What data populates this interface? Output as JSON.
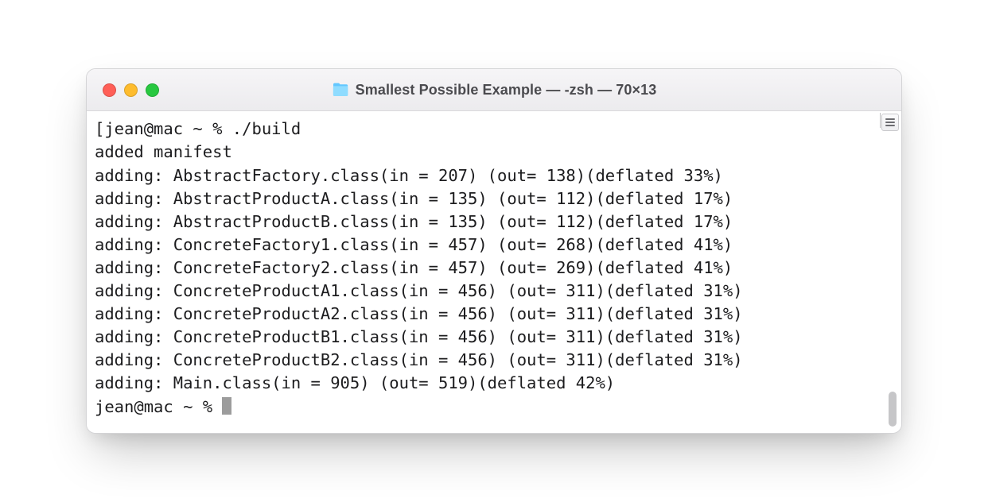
{
  "window": {
    "title": "Smallest Possible Example — -zsh — 70×13"
  },
  "session": {
    "prompt": "jean@mac ~ % ",
    "command": "./build",
    "manifest": "added manifest",
    "entries": [
      {
        "name": "AbstractFactory.class",
        "in": 207,
        "out": 138,
        "deflated": 33
      },
      {
        "name": "AbstractProductA.class",
        "in": 135,
        "out": 112,
        "deflated": 17
      },
      {
        "name": "AbstractProductB.class",
        "in": 135,
        "out": 112,
        "deflated": 17
      },
      {
        "name": "ConcreteFactory1.class",
        "in": 457,
        "out": 268,
        "deflated": 41
      },
      {
        "name": "ConcreteFactory2.class",
        "in": 457,
        "out": 269,
        "deflated": 41
      },
      {
        "name": "ConcreteProductA1.class",
        "in": 456,
        "out": 311,
        "deflated": 31
      },
      {
        "name": "ConcreteProductA2.class",
        "in": 456,
        "out": 311,
        "deflated": 31
      },
      {
        "name": "ConcreteProductB1.class",
        "in": 456,
        "out": 311,
        "deflated": 31
      },
      {
        "name": "ConcreteProductB2.class",
        "in": 456,
        "out": 311,
        "deflated": 31
      },
      {
        "name": "Main.class",
        "in": 905,
        "out": 519,
        "deflated": 42
      }
    ]
  }
}
